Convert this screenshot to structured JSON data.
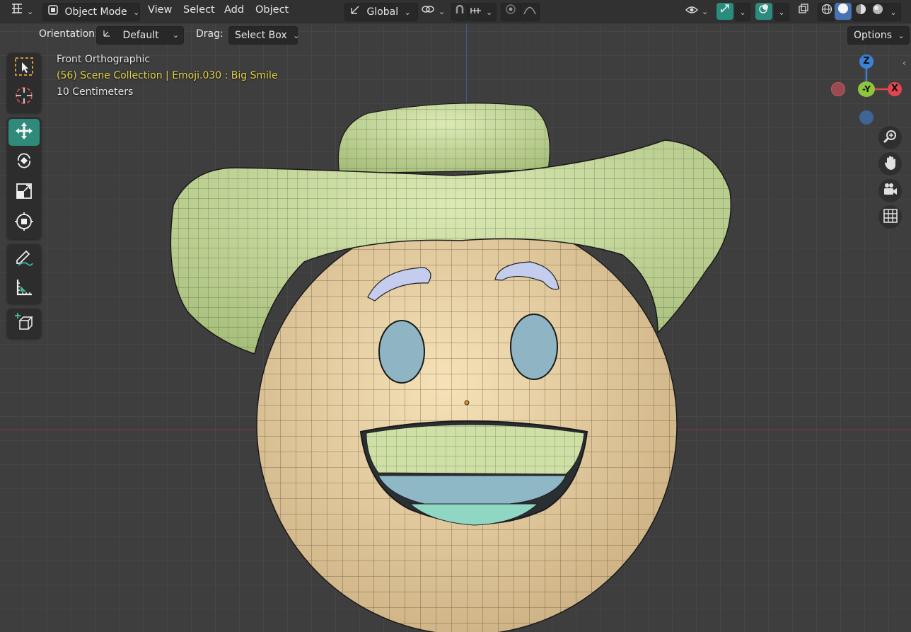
{
  "header": {
    "editor_type_icon": "grid-editor-icon",
    "mode": "Object Mode",
    "menus": [
      "View",
      "Select",
      "Add",
      "Object"
    ],
    "transform_orientation": "Global",
    "pivot_icon": "link-pivot-icon",
    "snap_icon": "magnet-icon",
    "snap_target_icon": "snap-increment-icon",
    "proportional_icon": "proportional-edit-icon",
    "falloff_icon": "falloff-curve-icon",
    "visibility_icon": "eye-icon",
    "gizmo_icon": "gizmo-arrow-icon",
    "overlay_icon": "overlay-circles-icon",
    "xray_icon": "xray-icon",
    "shading_icons": [
      "wireframe-shading-icon",
      "solid-shading-icon",
      "material-shading-icon",
      "rendered-shading-icon"
    ]
  },
  "tool_header": {
    "orientation_label": "Orientation:",
    "orientation_value": "Default",
    "drag_label": "Drag:",
    "drag_value": "Select Box",
    "options_label": "Options"
  },
  "overlay": {
    "view_name": "Front Orthographic",
    "collection_info": "(56) Scene Collection | Emoji.030 : Big Smile",
    "scale_info": "10 Centimeters"
  },
  "toolbar": {
    "tools": [
      "select-box-icon",
      "cursor-icon",
      "move-icon",
      "rotate-icon",
      "scale-icon",
      "transform-icon",
      "annotate-icon",
      "measure-icon",
      "add-cube-icon"
    ],
    "active_tool": "move-icon"
  },
  "navigation": {
    "gizmo_labels": {
      "z": "Z",
      "y": "-Y",
      "x": "X"
    },
    "nav_icons": [
      "zoom-icon",
      "hand-pan-icon",
      "camera-icon",
      "grid-ortho-icon"
    ]
  },
  "colors": {
    "x_axis": "#e2454f",
    "y_axis": "#8ec53c",
    "z_axis": "#3b82d6",
    "active_tool": "#2f8a7c",
    "overlay_highlight": "#e6d34a",
    "hat": "#c9dd9f",
    "face": "#ecd3a3"
  }
}
